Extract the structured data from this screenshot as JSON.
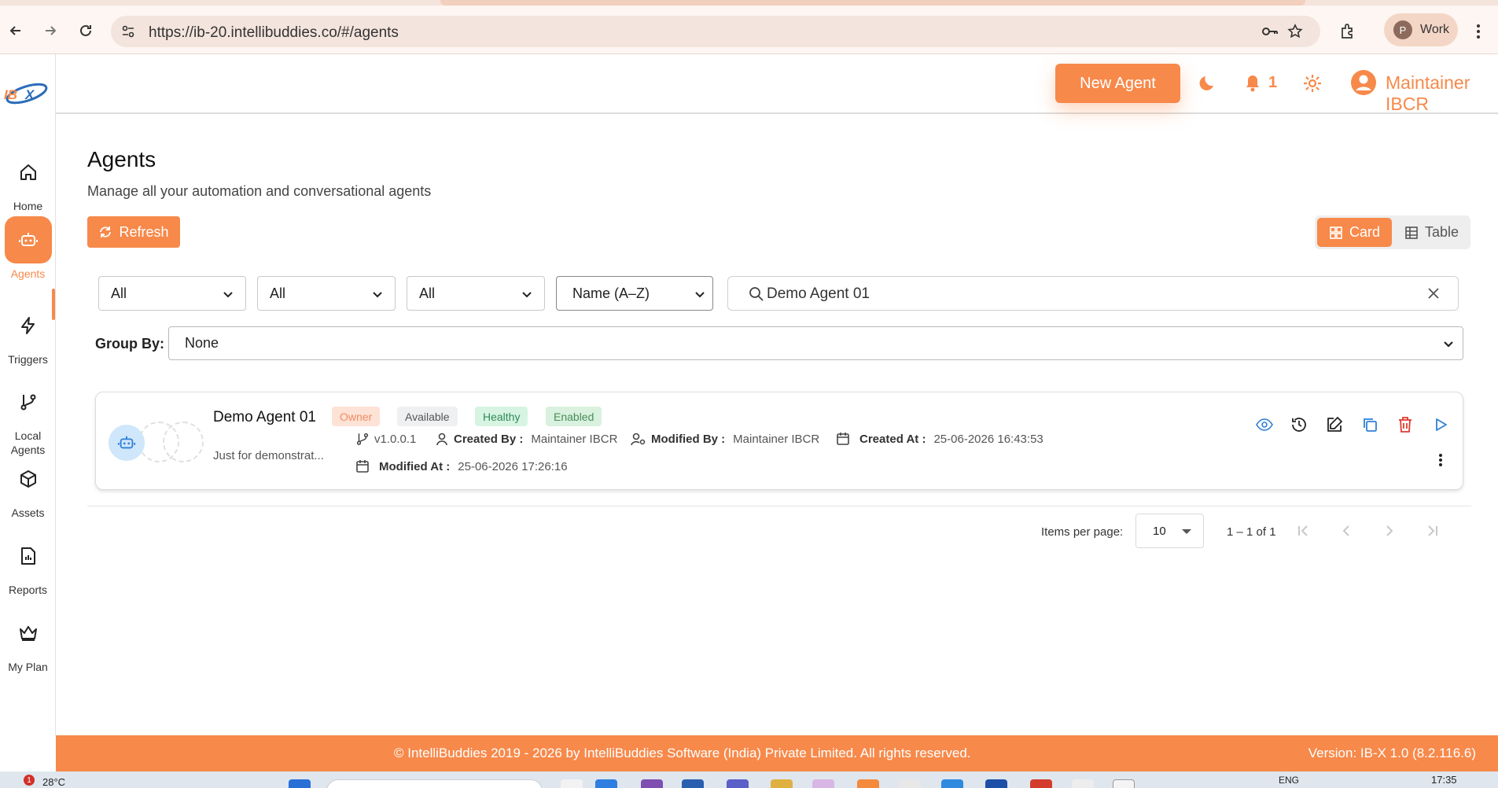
{
  "browser": {
    "url": "https://ib-20.intellibuddies.co/#/agents",
    "profile_initial": "P",
    "profile_label": "Work"
  },
  "brand": {
    "logo_text": "IBX",
    "accent": "#f7894a"
  },
  "sidebar": {
    "items": [
      {
        "label": "Home",
        "icon": "home-icon"
      },
      {
        "label": "Agents",
        "icon": "robot-icon",
        "active": true
      },
      {
        "label": "Triggers",
        "icon": "lightning-icon"
      },
      {
        "label": "Local Agents",
        "icon": "branch-icon"
      },
      {
        "label": "Assets",
        "icon": "cube-icon"
      },
      {
        "label": "Reports",
        "icon": "report-icon"
      },
      {
        "label": "My Plan",
        "icon": "crown-icon"
      }
    ]
  },
  "header": {
    "new_agent": "New Agent",
    "notifications": "1",
    "user": "Maintainer IBCR"
  },
  "page": {
    "title": "Agents",
    "subtitle": "Manage all your automation and conversational agents",
    "refresh": "Refresh",
    "view_card": "Card",
    "view_table": "Table"
  },
  "filters": {
    "f1": "All",
    "f2": "All",
    "f3": "All",
    "sort": "Name (A–Z)",
    "search_value": "Demo Agent 01",
    "group_by_label": "Group By:",
    "group_by_value": "None"
  },
  "agent": {
    "name": "Demo Agent 01",
    "badges": {
      "owner": "Owner",
      "available": "Available",
      "healthy": "Healthy",
      "enabled": "Enabled"
    },
    "description": "Just for demonstrat...",
    "version": "v1.0.0.1",
    "created_by_label": "Created By :",
    "created_by": "Maintainer IBCR",
    "modified_by_label": "Modified By :",
    "modified_by": "Maintainer IBCR",
    "created_at_label": "Created At :",
    "created_at": "25-06-2026 16:43:53",
    "modified_at_label": "Modified At :",
    "modified_at": "25-06-2026 17:26:16"
  },
  "pagination": {
    "items_per_page_label": "Items per page:",
    "items_per_page": "10",
    "range": "1 – 1 of 1"
  },
  "footer": {
    "copyright": "© IntelliBuddies 2019 - 2026 by IntelliBuddies Software (India) Private Limited. All rights reserved.",
    "version": "Version: IB-X 1.0 (8.2.116.6)"
  },
  "taskbar": {
    "weather_badge": "1",
    "temperature": "28°C",
    "lang": "ENG",
    "time": "17:35"
  }
}
